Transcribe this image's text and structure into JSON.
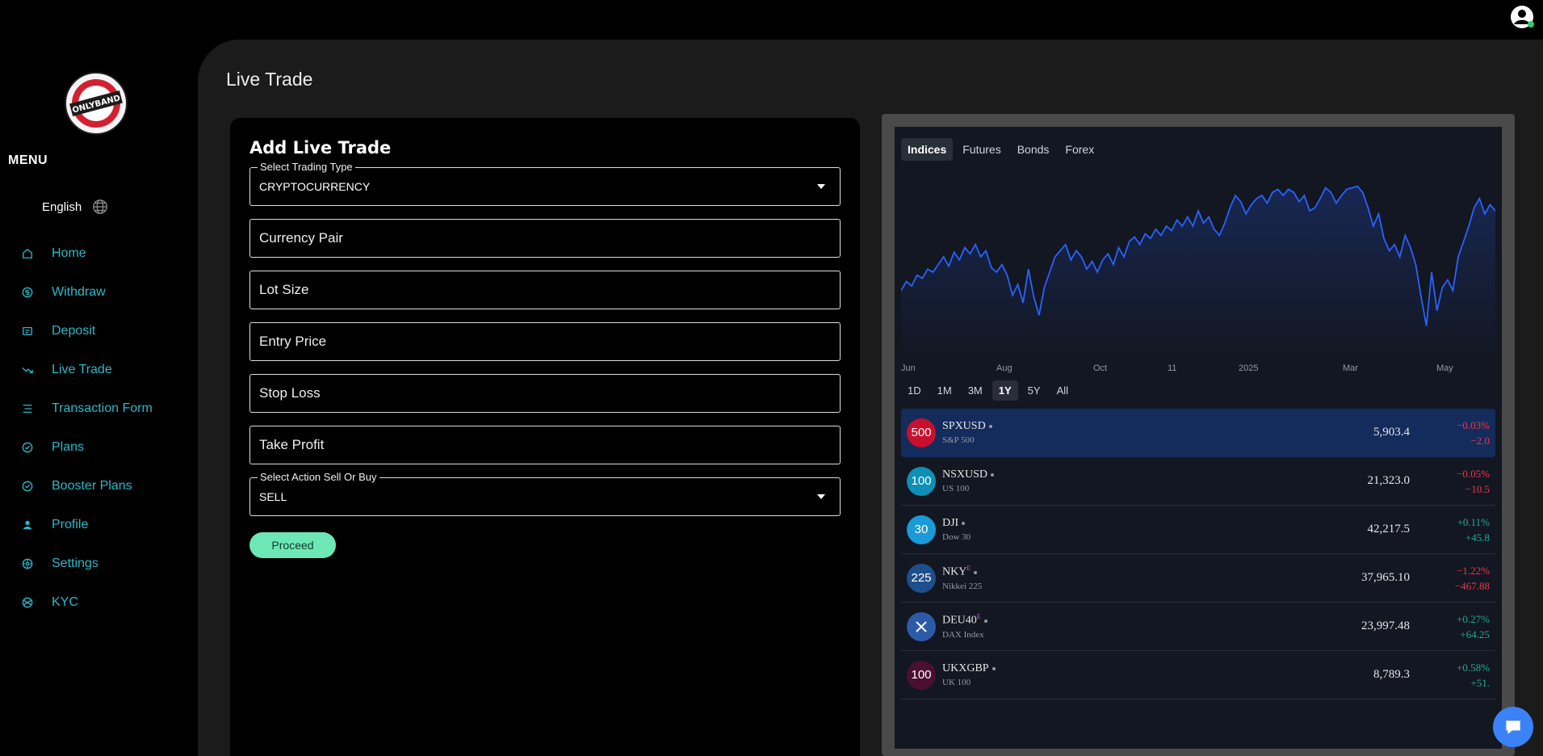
{
  "sidebar": {
    "menu_title": "MENU",
    "language": "English",
    "items": [
      {
        "label": "Home",
        "icon": "home-icon"
      },
      {
        "label": "Withdraw",
        "icon": "dollar-circle-icon"
      },
      {
        "label": "Deposit",
        "icon": "deposit-icon"
      },
      {
        "label": "Live Trade",
        "icon": "trend-down-icon"
      },
      {
        "label": "Transaction Form",
        "icon": "list-icon"
      },
      {
        "label": "Plans",
        "icon": "check-circle-icon"
      },
      {
        "label": "Booster Plans",
        "icon": "check-circle-icon"
      },
      {
        "label": "Profile",
        "icon": "person-icon"
      },
      {
        "label": "Settings",
        "icon": "gear-icon"
      },
      {
        "label": "KYC",
        "icon": "kyc-icon"
      }
    ]
  },
  "page": {
    "title": "Live Trade"
  },
  "form": {
    "heading": "Add Live Trade",
    "trading_type": {
      "label": "Select Trading Type",
      "value": "CRYPTOCURRENCY"
    },
    "fields": {
      "currency_pair": "Currency Pair",
      "lot_size": "Lot Size",
      "entry_price": "Entry Price",
      "stop_loss": "Stop Loss",
      "take_profit": "Take Profit"
    },
    "action": {
      "label": "Select Action Sell Or Buy",
      "value": "SELL"
    },
    "submit_label": "Proceed"
  },
  "widget": {
    "tabs": [
      "Indices",
      "Futures",
      "Bonds",
      "Forex"
    ],
    "active_tab": "Indices",
    "x_labels": [
      "Jun",
      "Aug",
      "Oct",
      "11",
      "2025",
      "Mar",
      "May"
    ],
    "periods": [
      "1D",
      "1M",
      "3M",
      "1Y",
      "5Y",
      "All"
    ],
    "active_period": "1Y",
    "rows": [
      {
        "badge": "500",
        "color": "#c8102e",
        "symbol": "SPXUSD",
        "sup": "",
        "name": "S&P 500",
        "price": "5,903.4",
        "pct": "−0.03%",
        "abs": "−2.0",
        "dir": "neg"
      },
      {
        "badge": "100",
        "color": "#0e8fb5",
        "symbol": "NSXUSD",
        "sup": "",
        "name": "US 100",
        "price": "21,323.0",
        "pct": "−0.05%",
        "abs": "−10.5",
        "dir": "neg"
      },
      {
        "badge": "30",
        "color": "#1a9ad6",
        "symbol": "DJI",
        "sup": "",
        "name": "Dow 30",
        "price": "42,217.5",
        "pct": "+0.11%",
        "abs": "+45.8",
        "dir": "pos"
      },
      {
        "badge": "225",
        "color": "#1f4e8c",
        "symbol": "NKY",
        "sup": "E",
        "name": "Nikkei 225",
        "price": "37,965.10",
        "pct": "−1.22%",
        "abs": "−467.88",
        "dir": "neg"
      },
      {
        "badge": "",
        "color": "#2d5aa8",
        "symbol": "DEU40",
        "sup": "E",
        "name": "DAX Index",
        "price": "23,997.48",
        "pct": "+0.27%",
        "abs": "+64.25",
        "dir": "pos"
      },
      {
        "badge": "100",
        "color": "#4a1030",
        "symbol": "UKXGBP",
        "sup": "",
        "name": "UK 100",
        "price": "8,789.3",
        "pct": "+0.58%",
        "abs": "+51.",
        "dir": "pos"
      }
    ]
  },
  "colors": {
    "accent": "#2bb8c9",
    "proceed": "#6ee7b7",
    "chart_line": "#2962ff",
    "highlight_row": "#142c5c",
    "negative": "#f23645",
    "positive": "#22ab94"
  }
}
